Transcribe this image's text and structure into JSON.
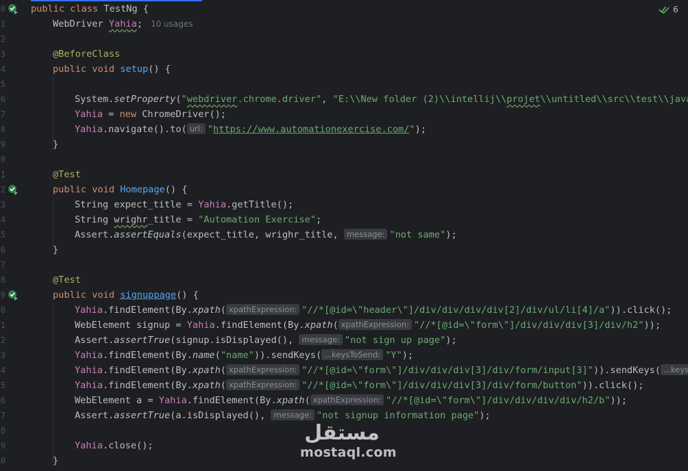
{
  "editor": {
    "inspections": {
      "count": "6",
      "icon": "check-double-icon"
    },
    "gutter_line_numbers": [
      "0",
      "1",
      "2",
      "3",
      "4",
      "5",
      "6",
      "7",
      "8",
      "9",
      "0",
      "1",
      "2",
      "3",
      "4",
      "5",
      "6",
      "7",
      "8",
      "9",
      "0",
      "1",
      "2",
      "3",
      "4",
      "5",
      "6",
      "7",
      "8",
      "9",
      "0"
    ],
    "usages_hint": "10 usages",
    "hints": {
      "url": "url:",
      "message": "message:",
      "xpath": "xpathExpression:",
      "keys": "...keysToSend:",
      "keys_truncated": "...keysTo"
    },
    "code": {
      "class_kw": "public class ",
      "class_name": "TestNg {",
      "field_type": "WebDriver ",
      "field_name": "Yahia",
      "semicolon": ";",
      "before_class": "@BeforeClass",
      "public_void": "public void ",
      "setup": "setup",
      "setup_sig": "() {",
      "sys_set": "System.",
      "set_property": "setProperty",
      "open_paren": "(",
      "str_q": "\"",
      "webdriver_word": "webdriver",
      "chrome_driver_key": ".chrome.driver",
      "comma_space": ", ",
      "path_part1": "\"E:\\\\New folder (2)\\\\intellij\\\\",
      "path_projet": "projet",
      "path_part2": "\\\\untitled\\\\src\\\\test\\\\java\\\\",
      "new_kw": "new",
      "chrome_driver_ctor": " ChromeDriver();",
      "eq": " = ",
      "navigate_to": ".navigate().to(",
      "url_value": "https://www.automationexercise.com/",
      "close_call": ");",
      "close_brace": "}",
      "at_test": "@Test",
      "homepage": "Homepage",
      "string_kw": "String ",
      "expect_title": "expect_title",
      "get_title": ".getTitle();",
      "wrighr_title": "wrighr",
      "title_suffix": "_title",
      "automation_exercise": "\"Automation Exercise\"",
      "assert_prefix": "Assert.",
      "assert_equals": "assertEquals",
      "assert_true": "assertTrue",
      "equals_args": "(expect_title, wrighr_title, ",
      "not_same": "\"not same\"",
      "signuppage": "signuppage",
      "find_element": ".findElement(By.",
      "xpath": "xpath",
      "name_fn": "name",
      "xp_header": "\"//*[@id=\\\"header\\\"]/div/div/div/div[2]/div/ul/li[4]/a\"",
      "click_end": ")).click();",
      "webelement_kw": "WebElement ",
      "signup_var": "signup",
      "xp_form_h2": "\"//*[@id=\\\"form\\\"]/div/div/div[3]/div/h2\"",
      "paren_end": "));",
      "signup_displayed": "(signup.isDisplayed(), ",
      "not_sign_up_page": "\"not sign up page\"",
      "name_str": "\"name\"",
      "send_keys_open": ")).sendKeys(",
      "y_str": "\"Y\"",
      "xp_form_input": "\"//*[@id=\\\"form\\\"]/div/div/div[3]/div/form/input[3]\"",
      "xp_form_button": "\"//*[@id=\\\"form\\\"]/div/div/div[3]/div/form/button\"",
      "a_var": "a",
      "xp_h2_b": "\"//*[@id=\\\"form\\\"]/div/div/div/div/h2/b\"",
      "a_displayed": "(a.isDisplayed(), ",
      "not_signup_info": "\"not signup information page\"",
      "close_method": ".close();"
    }
  },
  "watermark": {
    "logo_text": "مستقل",
    "site_text": "mostaql.com"
  }
}
